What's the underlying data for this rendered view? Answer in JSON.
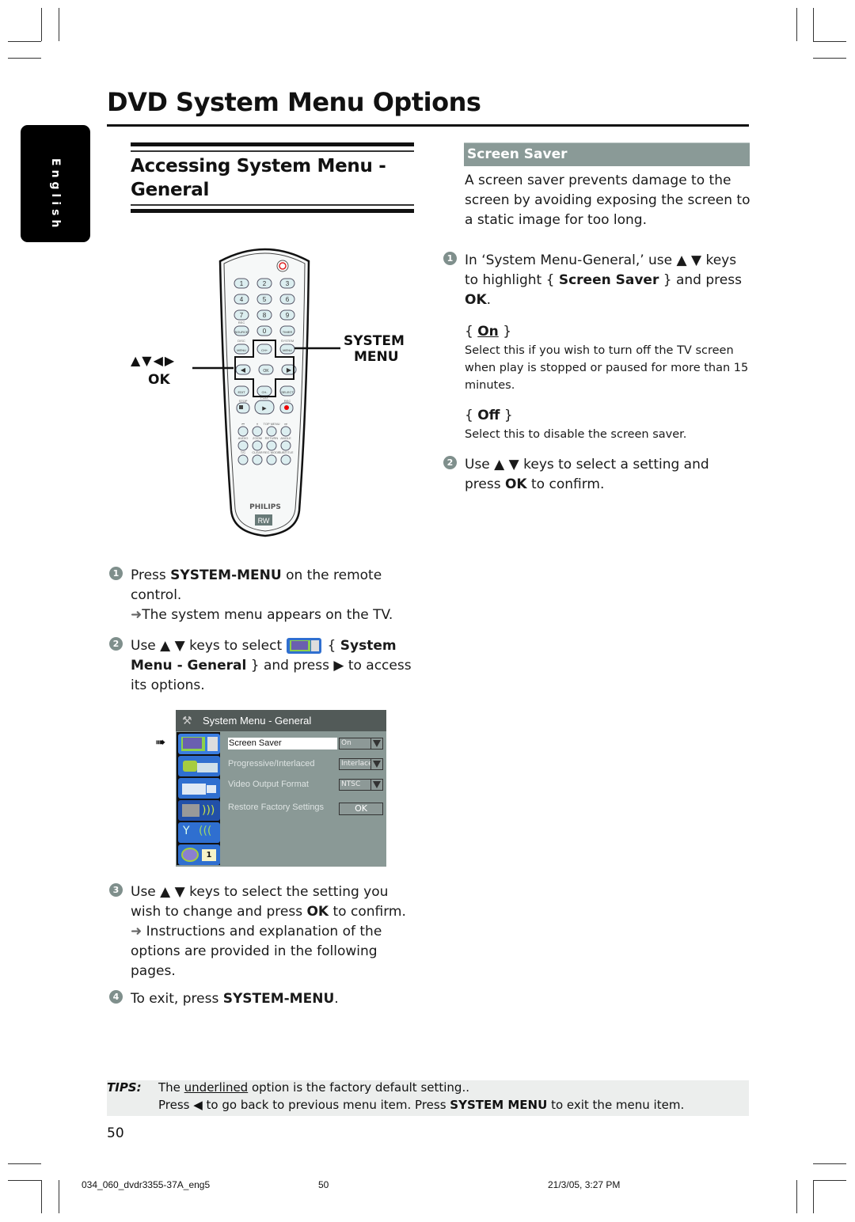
{
  "page": {
    "title": "DVD System Menu Options",
    "language_tab": "English",
    "page_number": "50"
  },
  "left": {
    "heading": "Accessing System Menu - General",
    "remote": {
      "callout_nav_arrows": "▲▼◀▶",
      "callout_ok": "OK",
      "callout_system": "SYSTEM",
      "callout_menu": "MENU",
      "brand": "PHILIPS",
      "rw_logo": "RW",
      "buttons": [
        "1",
        "2",
        "3",
        "4",
        "5",
        "6",
        "7",
        "8",
        "9",
        "SOURCE",
        "0",
        "TIMER",
        "MENU",
        "CH+",
        "MENU",
        "OK",
        "EDIT",
        "CH-",
        "SELECT"
      ],
      "labels": [
        "REC",
        "DISC",
        "SYSTEM",
        "STOP",
        "PLAY",
        "REC",
        "TOP MENU",
        "AUDIO",
        "ZOOM",
        "RETURN",
        "ANGLE",
        "T/C",
        "CLEAR",
        "REC MODE",
        "SUBTITLE"
      ]
    },
    "steps": [
      {
        "num": "1",
        "pre": "Press ",
        "bold": "SYSTEM-MENU",
        "post": " on the remote control.",
        "result": "The system menu appears on the TV."
      },
      {
        "num": "2",
        "pre": "Use ▲ ▼ keys to select ",
        "brace_open": "{ ",
        "bold1": "System Menu - General",
        "post": " } and press ▶ to access its options."
      },
      {
        "num": "3",
        "pre": "Use ▲ ▼ keys to select the setting you wish to change and press ",
        "bold": "OK",
        "post": " to confirm.",
        "result": "Instructions and explanation of the options are provided in the following pages."
      },
      {
        "num": "4",
        "pre": "To exit, press ",
        "bold": "SYSTEM-MENU",
        "post": "."
      }
    ]
  },
  "osd": {
    "title": "System Menu - General",
    "rows": [
      {
        "label": "Screen Saver",
        "value": "On",
        "selected": true
      },
      {
        "label": "Progressive/Interlaced",
        "value": "Interlaced"
      },
      {
        "label": "Video Output Format",
        "value": "NTSC"
      },
      {
        "label": "Restore Factory Settings",
        "value": "OK"
      }
    ],
    "icons": [
      "general-tv-icon",
      "video-projector-icon",
      "camcorder-icon",
      "speaker-icon",
      "antenna-icon",
      "clock-calendar-icon"
    ],
    "calendar_number": "1"
  },
  "right": {
    "section_title": "Screen Saver",
    "intro": "A screen saver prevents damage to the screen by avoiding exposing the screen to a static image for too long.",
    "step1": {
      "num": "1",
      "pre": "In ‘System Menu-General,’ use ▲ ▼ keys to highlight { ",
      "bold": "Screen Saver",
      "mid": " } and press ",
      "bold2": "OK",
      "post": "."
    },
    "options": [
      {
        "label": "On",
        "default": true,
        "desc": "Select this if you wish to turn off the TV screen when play is stopped or paused for more than 15 minutes."
      },
      {
        "label": "Off",
        "desc": "Select this to disable the screen saver."
      }
    ],
    "step2": {
      "num": "2",
      "pre": "Use ▲ ▼ keys to select a setting and press ",
      "bold": "OK",
      "post": " to confirm."
    }
  },
  "tips": {
    "label": "TIPS:",
    "line1_pre": "The ",
    "line1_underlined": "underlined",
    "line1_post": " option is the factory default setting..",
    "line2_pre": "Press ◀  to go back to previous menu item. Press ",
    "line2_bold": "SYSTEM MENU",
    "line2_post": " to exit the menu item."
  },
  "footer": {
    "file": "034_060_dvdr3355-37A_eng5",
    "page": "50",
    "date": "21/3/05, 3:27 PM"
  }
}
